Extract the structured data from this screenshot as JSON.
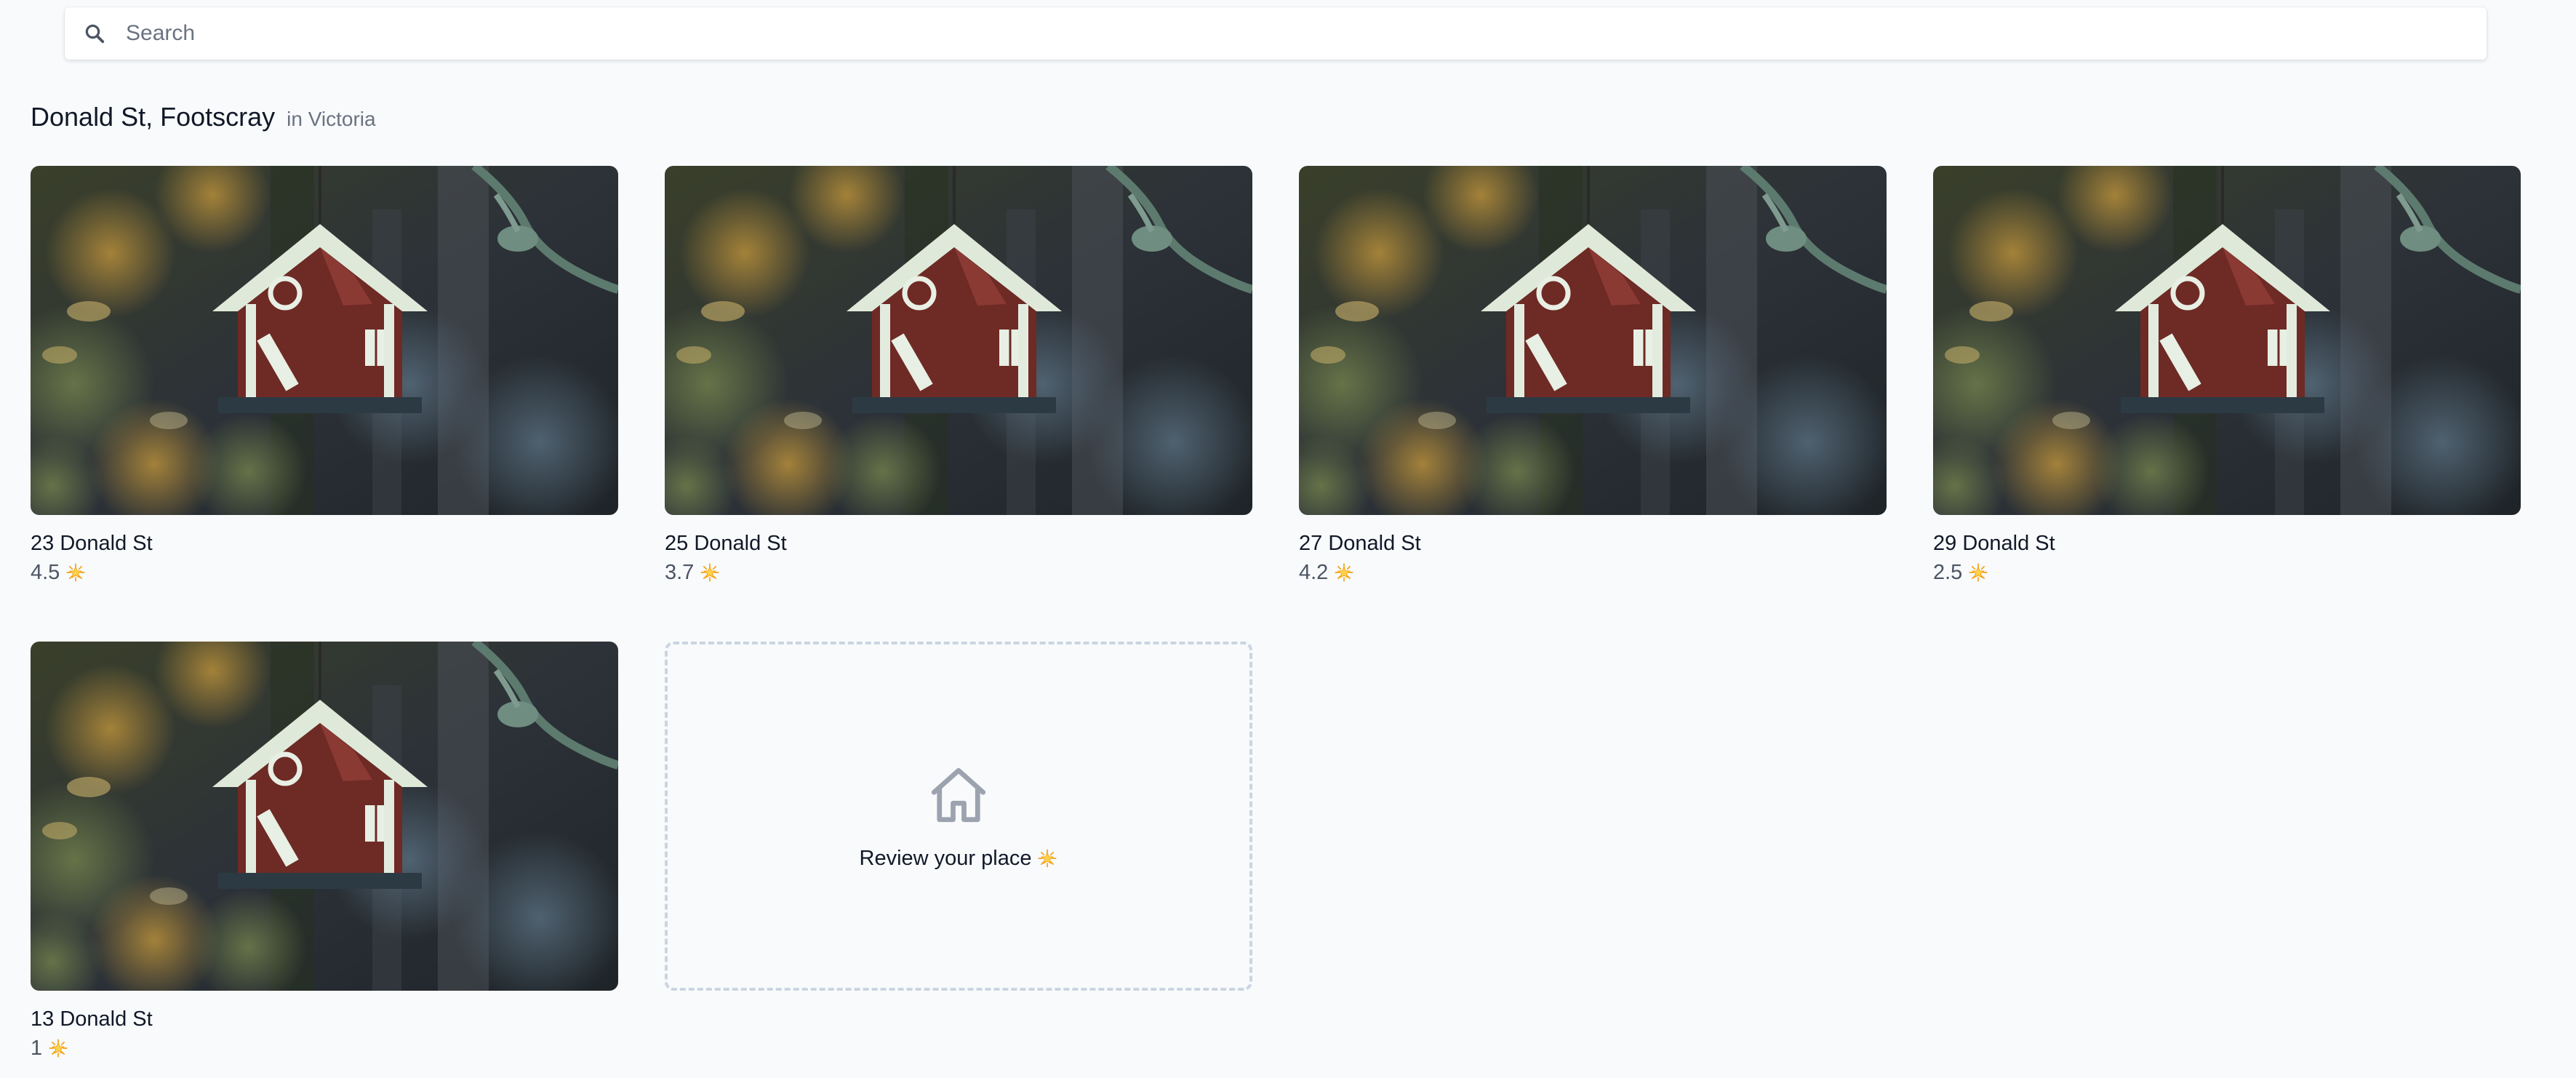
{
  "search": {
    "placeholder": "Search",
    "value": ""
  },
  "location": {
    "street": "Donald St, Footscray",
    "region": "in Victoria"
  },
  "places": [
    {
      "name": "23 Donald St",
      "rating": "4.5"
    },
    {
      "name": "25 Donald St",
      "rating": "3.7"
    },
    {
      "name": "27 Donald St",
      "rating": "4.2"
    },
    {
      "name": "29 Donald St",
      "rating": "2.5"
    },
    {
      "name": "13 Donald St",
      "rating": "1"
    }
  ],
  "review_cta": {
    "label": "Review your place"
  },
  "icons": {
    "search": "search-icon",
    "star": "star-icon",
    "home": "home-icon"
  },
  "colors": {
    "background": "#f8fafc",
    "text": "#111827",
    "muted": "#6b7280",
    "star": "#fbbf24",
    "dashed_border": "#cbd5e1"
  }
}
